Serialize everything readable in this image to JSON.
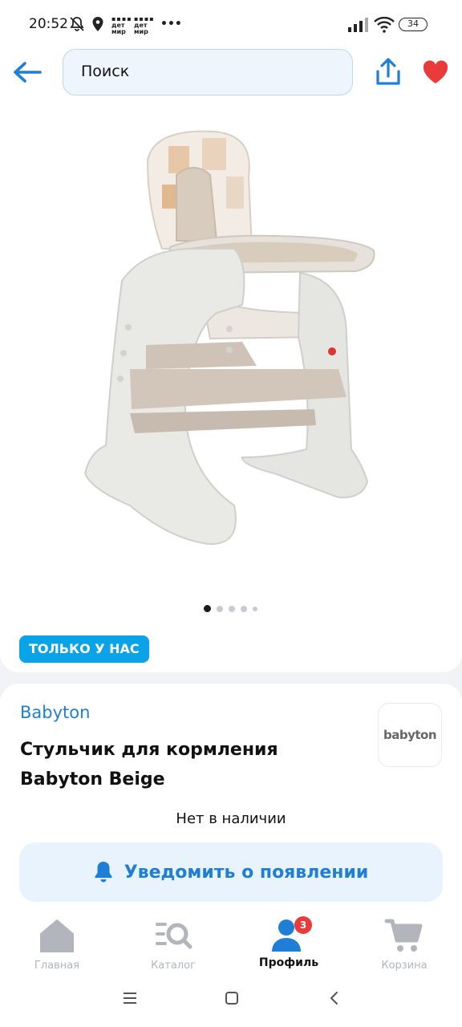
{
  "status_bar": {
    "time": "20:52",
    "carrier_logo_1": "дет мир",
    "carrier_logo_2": "дет мир",
    "more": "•••",
    "battery": "34",
    "icons": [
      "muted-bell-icon",
      "location-icon",
      "signal-icon",
      "wifi-icon",
      "battery-icon"
    ]
  },
  "top_bar": {
    "search_text": "Поиск",
    "icons": [
      "back-arrow-icon",
      "share-icon",
      "heart-icon"
    ]
  },
  "gallery": {
    "slide_count": 5,
    "active_slide": 1,
    "badge": "ТОЛЬКО У НАС",
    "image_alt": "baby high chair"
  },
  "product": {
    "brand": "Babyton",
    "brand_logo_text": "babyton",
    "title": "Стульчик для кормления Babyton Beige",
    "stock_status": "Нет в наличии",
    "notify_button": "Уведомить о появлении"
  },
  "bottom_nav": {
    "items": [
      {
        "label": "Главная",
        "icon": "home-icon",
        "active": false
      },
      {
        "label": "Каталог",
        "icon": "catalog-search-icon",
        "active": false
      },
      {
        "label": "Профиль",
        "icon": "profile-icon",
        "active": true,
        "badge": "3"
      },
      {
        "label": "Корзина",
        "icon": "cart-icon",
        "active": false
      }
    ]
  },
  "colors": {
    "accent": "#1f7fd6",
    "badge_blue": "#0aa3e8",
    "heart_red": "#ea3b3b"
  }
}
